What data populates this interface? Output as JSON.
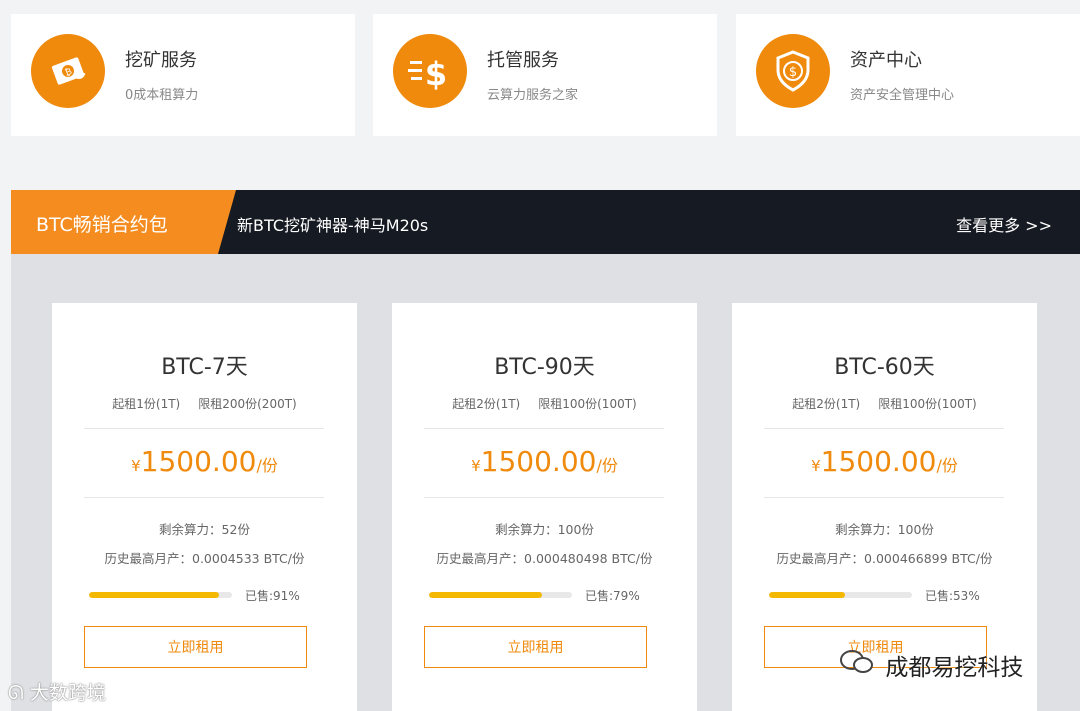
{
  "services": [
    {
      "title": "挖矿服务",
      "subtitle": "0成本租算力",
      "icon": "cash-coin-icon"
    },
    {
      "title": "托管服务",
      "subtitle": "云算力服务之家",
      "icon": "dollar-speed-icon"
    },
    {
      "title": "资产中心",
      "subtitle": "资产安全管理中心",
      "icon": "shield-dollar-icon"
    }
  ],
  "banner": {
    "tab_label": "BTC畅销合约包",
    "headline": "新BTC挖矿神器-神马M20s",
    "more_label": "查看更多 >>"
  },
  "colors": {
    "accent": "#f08a0c",
    "banner_bg": "#161a22",
    "tab": "#f58c20",
    "progress": "#f5b800"
  },
  "cards": [
    {
      "name": "BTC-7天",
      "min": "起租1份(1T)",
      "max": "限租200份(200T)",
      "currency": "¥",
      "price": "1500.00",
      "unit": "/份",
      "remaining": "剩余算力：52份",
      "history": "历史最高月产：0.0004533 BTC/份",
      "sold_label": "已售:91%",
      "sold": 0.91,
      "button": "立即租用"
    },
    {
      "name": "BTC-90天",
      "min": "起租2份(1T)",
      "max": "限租100份(100T)",
      "currency": "¥",
      "price": "1500.00",
      "unit": "/份",
      "remaining": "剩余算力：100份",
      "history": "历史最高月产：0.000480498 BTC/份",
      "sold_label": "已售:79%",
      "sold": 0.79,
      "button": "立即租用"
    },
    {
      "name": "BTC-60天",
      "min": "起租2份(1T)",
      "max": "限租100份(100T)",
      "currency": "¥",
      "price": "1500.00",
      "unit": "/份",
      "remaining": "剩余算力：100份",
      "history": "历史最高月产：0.000466899 BTC/份",
      "sold_label": "已售:53%",
      "sold": 0.53,
      "button": "立即租用"
    }
  ],
  "watermarks": {
    "left": "大数跨境",
    "right": "成都易挖科技"
  }
}
